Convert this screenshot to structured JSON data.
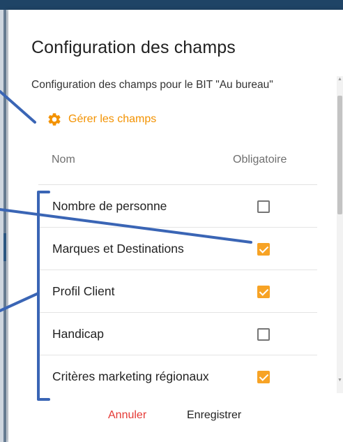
{
  "dialog": {
    "title": "Configuration des champs",
    "subtitle": "Configuration des champs pour le BIT \"Au bureau\"",
    "manage_label": "Gérer les champs",
    "columns": {
      "name": "Nom",
      "required": "Obligatoire"
    },
    "rows": [
      {
        "label": "Nombre de personne",
        "required": false
      },
      {
        "label": "Marques et Destinations",
        "required": true
      },
      {
        "label": "Profil Client",
        "required": true
      },
      {
        "label": "Handicap",
        "required": false
      },
      {
        "label": "Critères marketing régionaux",
        "required": true
      }
    ],
    "actions": {
      "cancel": "Annuler",
      "save": "Enregistrer"
    }
  },
  "colors": {
    "accent": "#f39200",
    "checkbox_checked": "#f7a325",
    "cancel": "#e53935",
    "annotation": "#3a65b5",
    "header_bar": "#1f4466"
  },
  "icons": {
    "manage": "gear-icon"
  }
}
